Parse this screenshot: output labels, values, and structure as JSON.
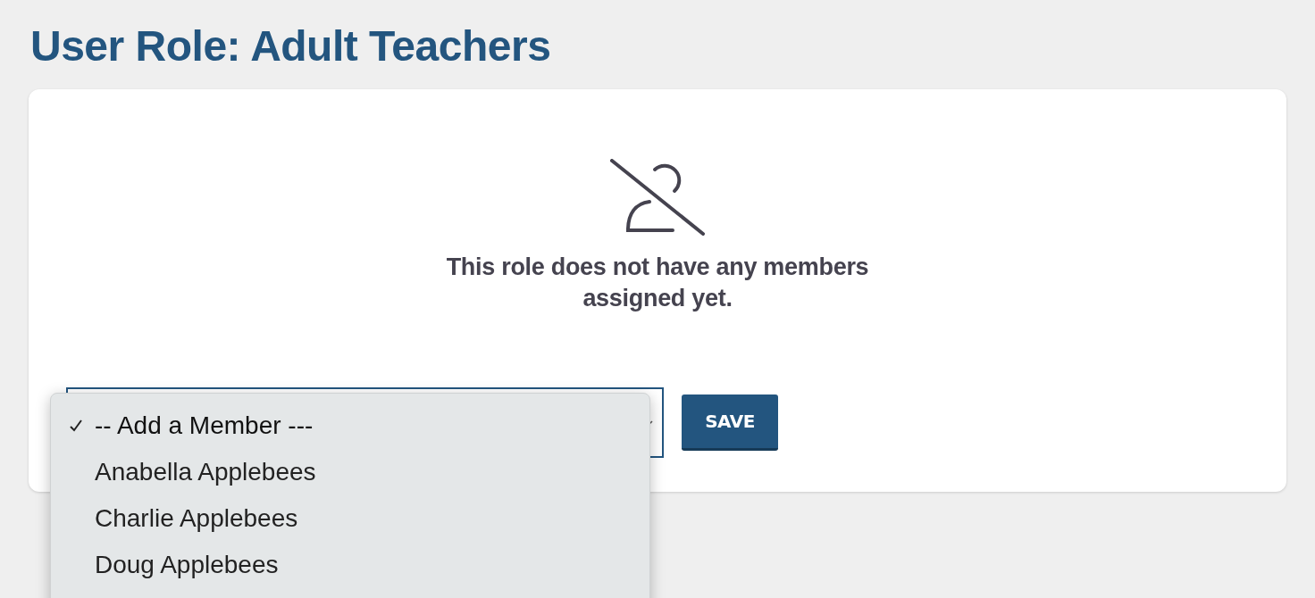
{
  "page_title": "User Role: Adult Teachers",
  "empty_state": {
    "message": "This role does not have any members assigned yet."
  },
  "member_select": {
    "expanded": true,
    "options": [
      {
        "label": "-- Add a Member ---",
        "selected": true
      },
      {
        "label": "Anabella Applebees",
        "selected": false
      },
      {
        "label": "Charlie Applebees",
        "selected": false
      },
      {
        "label": "Doug Applebees",
        "selected": false
      }
    ]
  },
  "save_button": "SAVE"
}
